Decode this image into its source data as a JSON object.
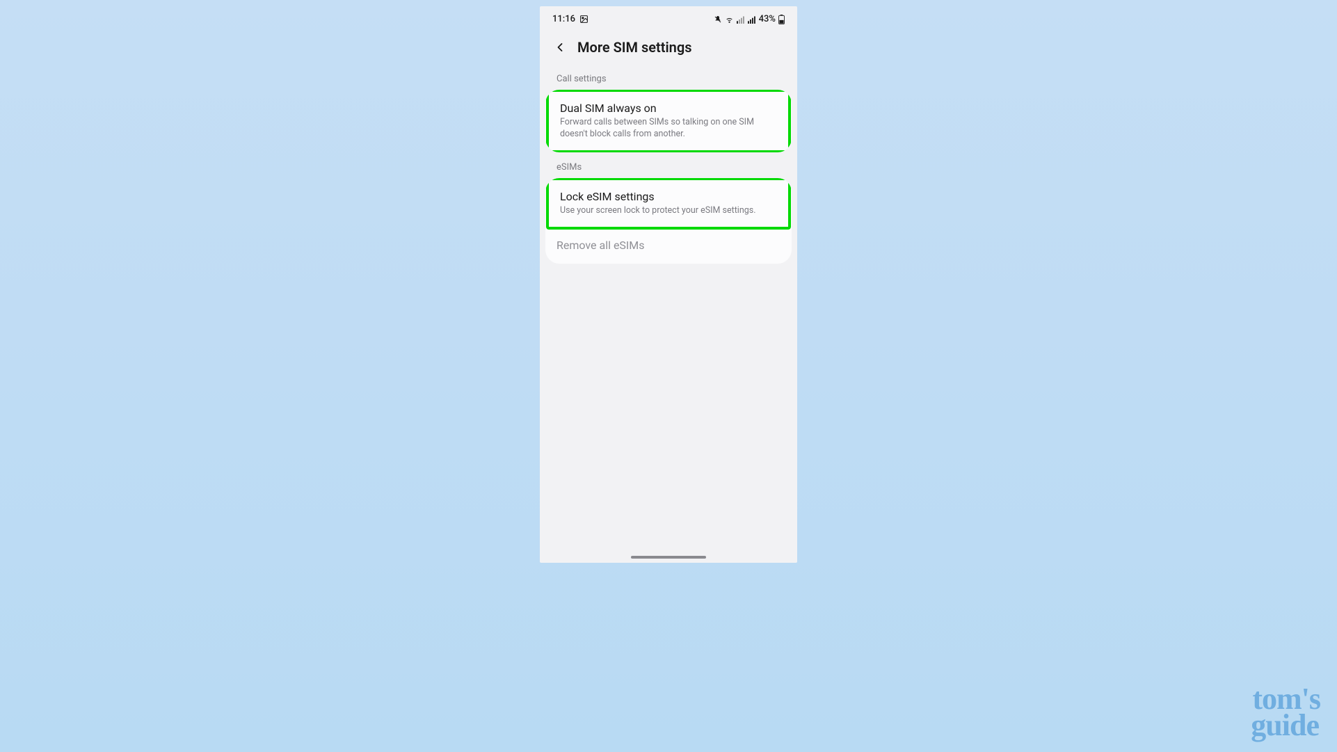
{
  "status": {
    "time": "11:16",
    "battery_text": "43%"
  },
  "header": {
    "title": "More SIM settings"
  },
  "sections": {
    "call_settings_label": "Call settings",
    "esims_label": "eSIMs"
  },
  "items": {
    "dual_sim": {
      "title": "Dual SIM always on",
      "desc": "Forward calls between SIMs so talking on one SIM doesn't block calls from another."
    },
    "lock_esim": {
      "title": "Lock eSIM settings",
      "desc": "Use your screen lock to protect your eSIM settings."
    },
    "remove_all": {
      "title": "Remove all eSIMs"
    }
  },
  "brand": {
    "line1": "tom's",
    "line2": "guide"
  },
  "colors": {
    "highlight": "#00d900",
    "bg_top": "#c5def5",
    "bg_bottom": "#b8daf3",
    "phone_bg": "#f2f2f4",
    "card_bg": "#fcfcfd",
    "brand": "#70aee0"
  }
}
